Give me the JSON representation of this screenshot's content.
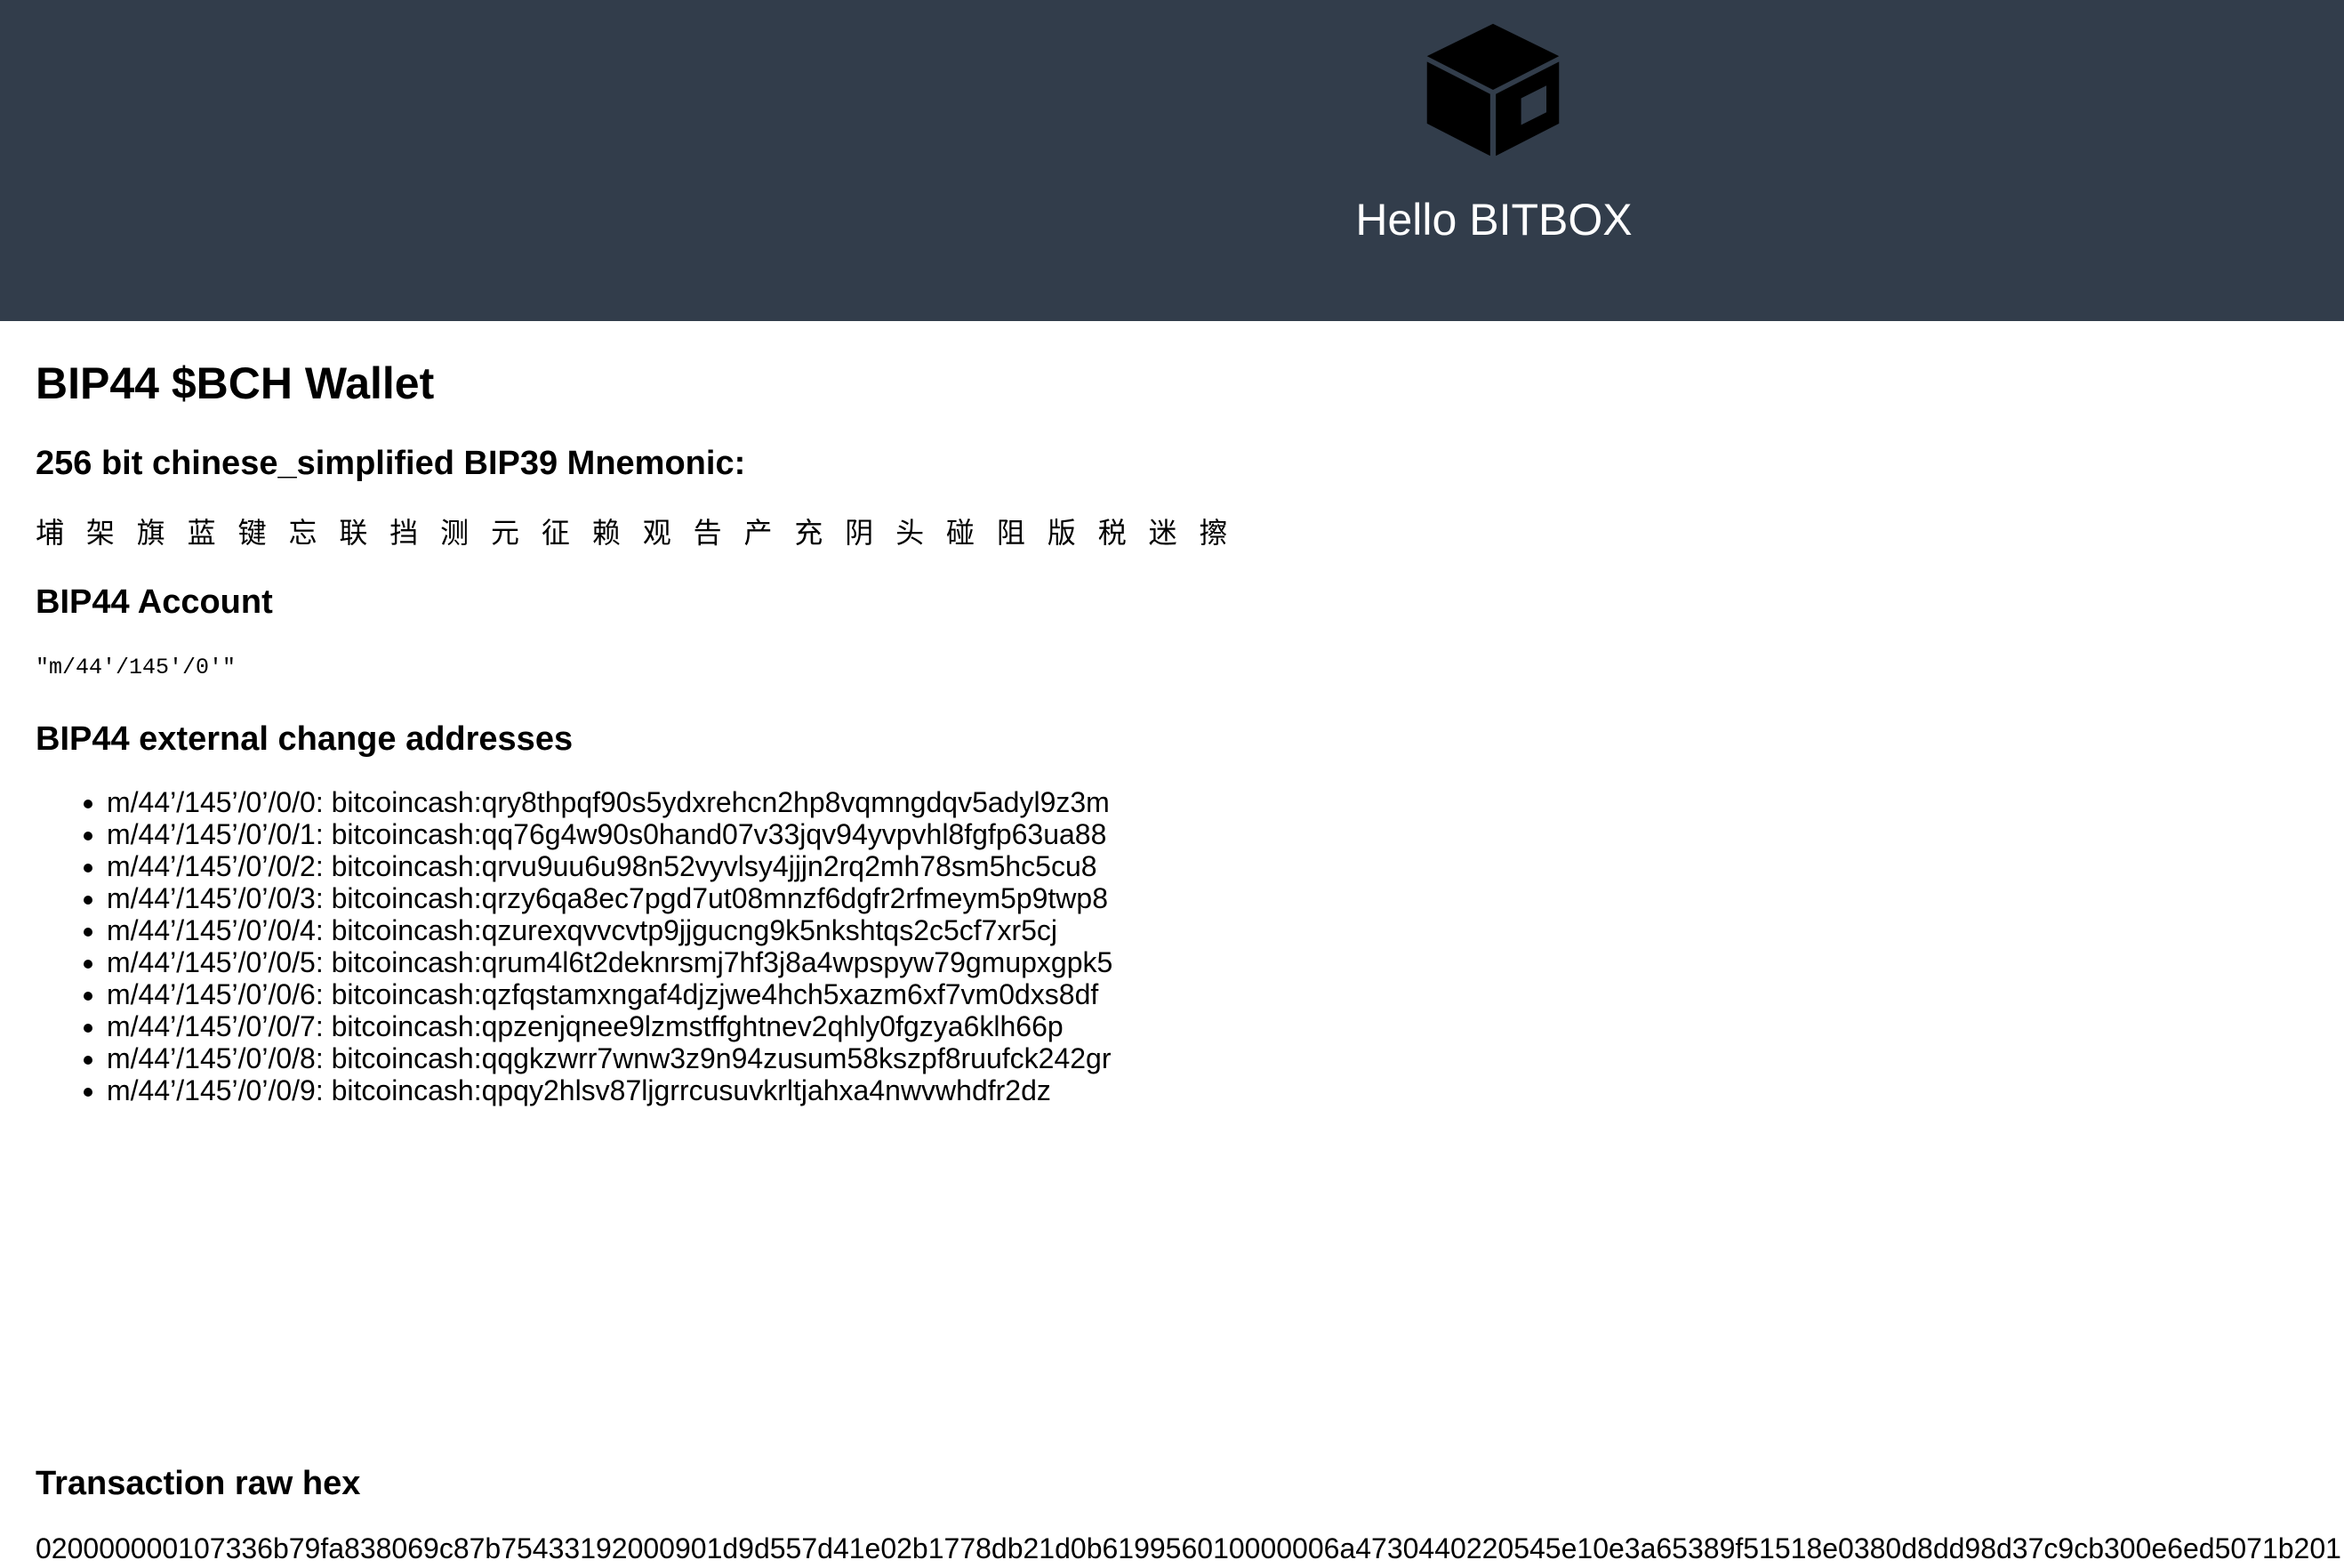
{
  "header": {
    "logo_icon": "cube-icon",
    "title": "Hello BITBOX",
    "background_color": "#323d4b"
  },
  "main": {
    "heading": "BIP44 $BCH Wallet",
    "mnemonic_heading": "256 bit chinese_simplified BIP39 Mnemonic:",
    "mnemonic": "埔 架 旗 蓝 键 忘 联 挡 测 元 征 赖 观 告 产 充 阴 头 碰 阻 版 税 迷 擦",
    "account_heading": "BIP44 Account",
    "account_path": "\"m/44'/145'/0'\"",
    "addresses_heading": "BIP44 external change addresses",
    "addresses": [
      "m/44’/145’/0’/0/0: bitcoincash:qry8thpqf90s5ydxrehcn2hp8vqmngdqv5adyl9z3m",
      "m/44’/145’/0’/0/1: bitcoincash:qq76g4w90s0hand07v33jqv94yvpvhl8fgfp63ua88",
      "m/44’/145’/0’/0/2: bitcoincash:qrvu9uu6u98n52vyvlsy4jjjn2rq2mh78sm5hc5cu8",
      "m/44’/145’/0’/0/3: bitcoincash:qrzy6qa8ec7pgd7ut08mnzf6dgfr2rfmeym5p9twp8",
      "m/44’/145’/0’/0/4: bitcoincash:qzurexqvvcvtp9jjgucng9k5nkshtqs2c5cf7xr5cj",
      "m/44’/145’/0’/0/5: bitcoincash:qrum4l6t2deknrsmj7hf3j8a4wpspyw79gmupxgpk5",
      "m/44’/145’/0’/0/6: bitcoincash:qzfqstamxngaf4djzjwe4hch5xazm6xf7vm0dxs8df",
      "m/44’/145’/0’/0/7: bitcoincash:qpzenjqnee9lzmstffghtnev2qhly0fgzya6klh66p",
      "m/44’/145’/0’/0/8: bitcoincash:qqgkzwrr7wnw3z9n94zusum58kszpf8ruufck242gr",
      "m/44’/145’/0’/0/9: bitcoincash:qpqy2hlsv87ljgrrcusuvkrltjahxa4nwvwhdfr2dz"
    ],
    "raw_hex_heading": "Transaction raw hex",
    "raw_hex": "020000000107336b79fa838069c87b75433192000901d9d557d41e02b1778db21d0b619956010000006a4730440220545e10e3a65389f51518e0380d8dd98d37c9cb300e6ed5071b201"
  }
}
